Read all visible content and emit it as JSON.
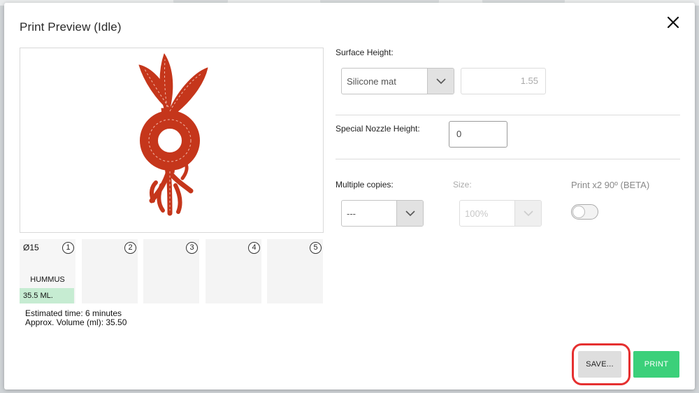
{
  "modal": {
    "title": "Print Preview (Idle)"
  },
  "preview": {
    "shape_color": "#c5361b"
  },
  "slots": [
    {
      "number": "1",
      "size": "Ø15",
      "name": "HUMMUS",
      "volume": "35.5 ML."
    },
    {
      "number": "2"
    },
    {
      "number": "3"
    },
    {
      "number": "4"
    },
    {
      "number": "5"
    }
  ],
  "estimate": {
    "time": "Estimated time: 6 minutes",
    "volume": "Approx. Volume (ml): 35.50"
  },
  "form": {
    "surface_height_label": "Surface Height:",
    "surface_select_value": "Silicone mat",
    "surface_height_value": "1.55",
    "nozzle_label": "Special Nozzle Height:",
    "nozzle_value": "0",
    "copies_label": "Multiple copies:",
    "copies_value": "---",
    "size_label": "Size:",
    "size_value": "100%",
    "rotate_label": "Print x2 90º (BETA)",
    "rotate_enabled": false
  },
  "actions": {
    "save_label": "SAVE...",
    "print_label": "PRINT"
  },
  "colors": {
    "accent_green": "#3bd07a",
    "highlight_red": "#e53030",
    "volume_bar": "#c6ecd2"
  }
}
